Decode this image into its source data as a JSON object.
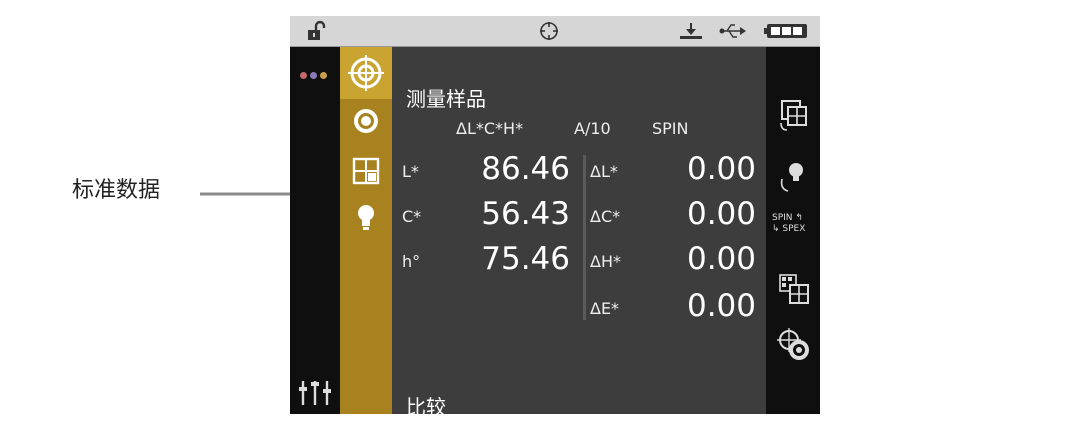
{
  "callout": {
    "label": "标准数据"
  },
  "colors": {
    "gold": "#a8821e",
    "gold_selected": "#c9a431",
    "screen_bg": "#3d3d3d"
  },
  "statusbar": {
    "icons": [
      "unlock-icon",
      "target-icon",
      "download-icon",
      "usb-icon",
      "battery-icon"
    ]
  },
  "sidebar": {
    "items": [
      "target-measure-icon",
      "ring-icon",
      "grid-icon",
      "bulb-icon"
    ],
    "bottom_icon": "sliders-icon",
    "menu_icon": "dots-menu-icon"
  },
  "main": {
    "title": "测量样品",
    "header": {
      "mode": "ΔL*C*H*",
      "observer": "A/10",
      "spec": "SPIN"
    },
    "standard": [
      {
        "label": "L*",
        "value": "86.46"
      },
      {
        "label": "C*",
        "value": "56.43"
      },
      {
        "label": "h°",
        "value": "75.46"
      }
    ],
    "delta": [
      {
        "label": "ΔL*",
        "value": "0.00"
      },
      {
        "label": "ΔC*",
        "value": "0.00"
      },
      {
        "label": "ΔH*",
        "value": "0.00"
      },
      {
        "label": "ΔE*",
        "value": "0.00"
      }
    ],
    "bottom_label": "比较"
  },
  "right_rail": {
    "items": [
      "rotate-grid-icon",
      "rotate-bulb-icon",
      "spin-spex-toggle",
      "multi-grid-icon",
      "target-swap-icon"
    ],
    "spin_label": "SPIN",
    "spex_label": "SPEX"
  }
}
